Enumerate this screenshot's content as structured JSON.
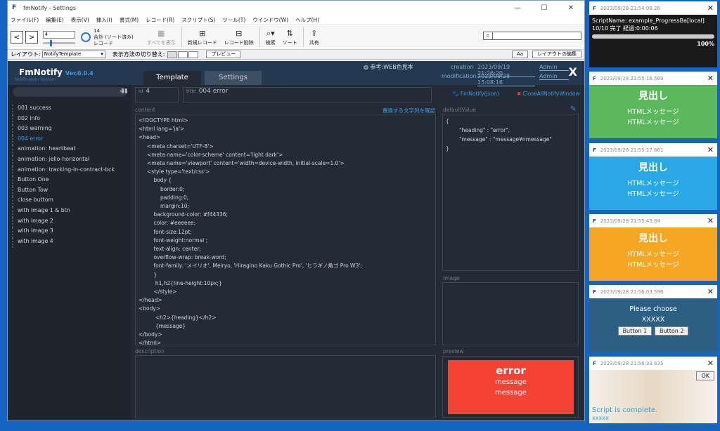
{
  "window": {
    "title": "fmNotify - Settings",
    "ctrl_min": "—",
    "ctrl_max": "☐",
    "ctrl_close": "✕"
  },
  "menu": [
    "ファイル(F)",
    "編集(E)",
    "表示(V)",
    "挿入(I)",
    "書式(M)",
    "レコード(R)",
    "スクリプト(S)",
    "ツール(T)",
    "ウインドウ(W)",
    "ヘルプ(H)"
  ],
  "toolbar": {
    "record_value": "4",
    "count_total": "14",
    "count_sort": "合計 (ソート済み)",
    "count_unit": "レコード",
    "show_all": "すべてを表示",
    "new_record": "新規レコード",
    "delete_record": "レコード削除",
    "find": "検索",
    "sort": "ソート",
    "share": "共有"
  },
  "layoutbar": {
    "layout_label": "レイアウト:",
    "layout_value": "NotifyTemplate",
    "view_label": "表示方法の切り替え:",
    "preview": "プレビュー",
    "aa": "Aa",
    "edit_layout": "レイアウトの編集"
  },
  "header": {
    "brand": "FmNotify",
    "version": "Ver.0.0.4",
    "subtitle": "Notification System",
    "tab_template": "Template",
    "tab_settings": "Settings",
    "reference": "参考:WEB色見本",
    "creation_label": "creation",
    "creation_date": "2023/09/19 21:26:20",
    "creation_user": "Admin",
    "modification_label": "modification",
    "modification_date": "2023/09/28 15:08:16",
    "modification_user": "Admin",
    "x": "X"
  },
  "sidebar": {
    "items": [
      "001 success",
      "002 info",
      "003 warning",
      "004 error",
      "animation: heartbeat",
      "animation: jello-horizontal",
      "animation: tracking-in-contract-bck",
      "Button One",
      "Button Tow",
      "close buttom",
      "with image 1 & btn",
      "with image 2",
      "with image 3",
      "with image 4"
    ]
  },
  "form": {
    "id_label": "id",
    "id_value": "4",
    "title_label": "title",
    "title_value": "004 error",
    "fmnotify_link": "FmNotify(Json)",
    "closeall_link": "CloseAllNotifyWindow",
    "content_label": "content",
    "replace_link": "置換する文字列を確認",
    "defaultvalue_label": "defaultValue",
    "image_label": "image",
    "description_label": "description",
    "preview_label": "preview",
    "content_code": "<!DOCTYPE html>\n<html lang='ja'>\n<head>\n     <meta charset='UTF-8'>\n     <meta name='color-scheme' content='light dark'>\n     <meta name='viewport' content='width=device-width, initial-scale=1.0'>\n     <style type='text/css'>\n         body {\n             border:0;\n             padding:0;\n             margin:10;\n         background-color: #f44336;\n         color: #eeeeee;\n         font-size:12pt;\n         font-weight:normal ;\n         text-align: center;\n         overflow-wrap: break-word;\n         font-family: 'メイリオ', Meiryo, 'Hiragino Kaku Gothic Pro', 'ヒラギノ角ゴ Pro W3';\n         }\n          h1,h2{line-height:10px;}\n         </style>\n</head>\n<body>\n          <h2>{heading}</h2>\n          {message}\n</body>\n</html>",
    "default_value": "{\n        \"heading\" : \"error\",\n        \"message\" : \"message¥nmessage\"\n}",
    "preview_heading": "error",
    "preview_msg1": "message",
    "preview_msg2": "message"
  },
  "popups": [
    {
      "time": "2023/09/28 21:54:08.26",
      "line1": "ScriptName: example_ProgressBa[local]",
      "line2": "10/10 完了 経過:0:00:06",
      "percent": "100%",
      "bg": "#1a1a1a"
    },
    {
      "time": "2023/09/28 21:55:16.569",
      "heading": "見出し",
      "msg1": "HTMLメッセージ",
      "msg2": "HTMLメッセージ",
      "bg": "#5cb85c"
    },
    {
      "time": "2023/09/28 21:55:17.661",
      "heading": "見出し",
      "msg1": "HTMLメッセージ",
      "msg2": "HTMLメッセージ",
      "bg": "#29a8e8"
    },
    {
      "time": "2023/09/28 21:55:45.84",
      "heading": "見出し",
      "msg1": "HTMLメッセージ",
      "msg2": "HTMLメッセージ",
      "bg": "#f5a623"
    },
    {
      "time": "2023/09/28 21:56:03.596",
      "line1": "Please choose",
      "line2": "XXXXX",
      "btn1": "Button 1",
      "btn2": "Button 2",
      "bg": "#2d5f85"
    },
    {
      "time": "2023/09/28 21:56:33.635",
      "ok": "OK",
      "line1": "Script is complete.",
      "line2": "xxxxx",
      "bg": "#e8e2da"
    }
  ]
}
